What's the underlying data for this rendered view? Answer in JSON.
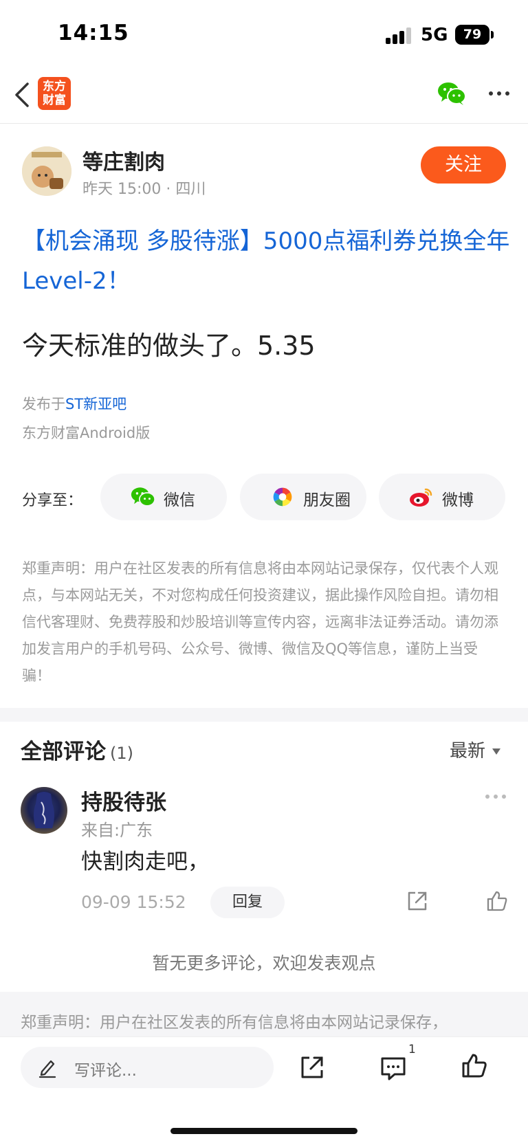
{
  "status_bar": {
    "time": "14:15",
    "network": "5G",
    "battery": "79"
  },
  "nav": {
    "brand_line1": "东方",
    "brand_line2": "财富"
  },
  "author": {
    "name": "等庄割肉",
    "meta": "昨天 15:00 · 四川",
    "follow_label": "关注"
  },
  "post": {
    "title": "【机会涌现 多股待涨】5000点福利券兑换全年Level-2！",
    "body": "今天标准的做头了。5.35",
    "published_prefix": "发布于",
    "published_link": "ST新亚吧",
    "client": "东方财富Android版"
  },
  "share": {
    "label": "分享至：",
    "wechat": "微信",
    "moments": "朋友圈",
    "weibo": "微博"
  },
  "disclaimer": "郑重声明：用户在社区发表的所有信息将由本网站记录保存，仅代表个人观点，与本网站无关，不对您构成任何投资建议，据此操作风险自担。请勿相信代客理财、免费荐股和炒股培训等宣传内容，远离非法证券活动。请勿添加发言用户的手机号码、公众号、微博、微信及QQ等信息，谨防上当受骗！",
  "comments": {
    "title": "全部评论",
    "count": "(1)",
    "sort": "最新",
    "items": [
      {
        "user": "持股待张",
        "location": "来自:广东",
        "text": "快割肉走吧，",
        "time": "09-09 15:52",
        "reply_label": "回复"
      }
    ],
    "no_more": "暂无更多评论，欢迎发表观点"
  },
  "footer": {
    "text": "郑重声明：用户在社区发表的所有信息将由本网站记录保存，"
  },
  "bottom_bar": {
    "input_placeholder": "写评论...",
    "comments_badge": "1"
  },
  "colors": {
    "accent": "#fb5a1c",
    "link": "#1565d6",
    "wechat": "#2dc100",
    "weibo": "#e6162d"
  },
  "icons": [
    "back-icon",
    "wechat-icon",
    "more-icon",
    "moments-icon",
    "weibo-icon",
    "share-icon",
    "like-icon",
    "pencil-icon",
    "comments-icon"
  ]
}
